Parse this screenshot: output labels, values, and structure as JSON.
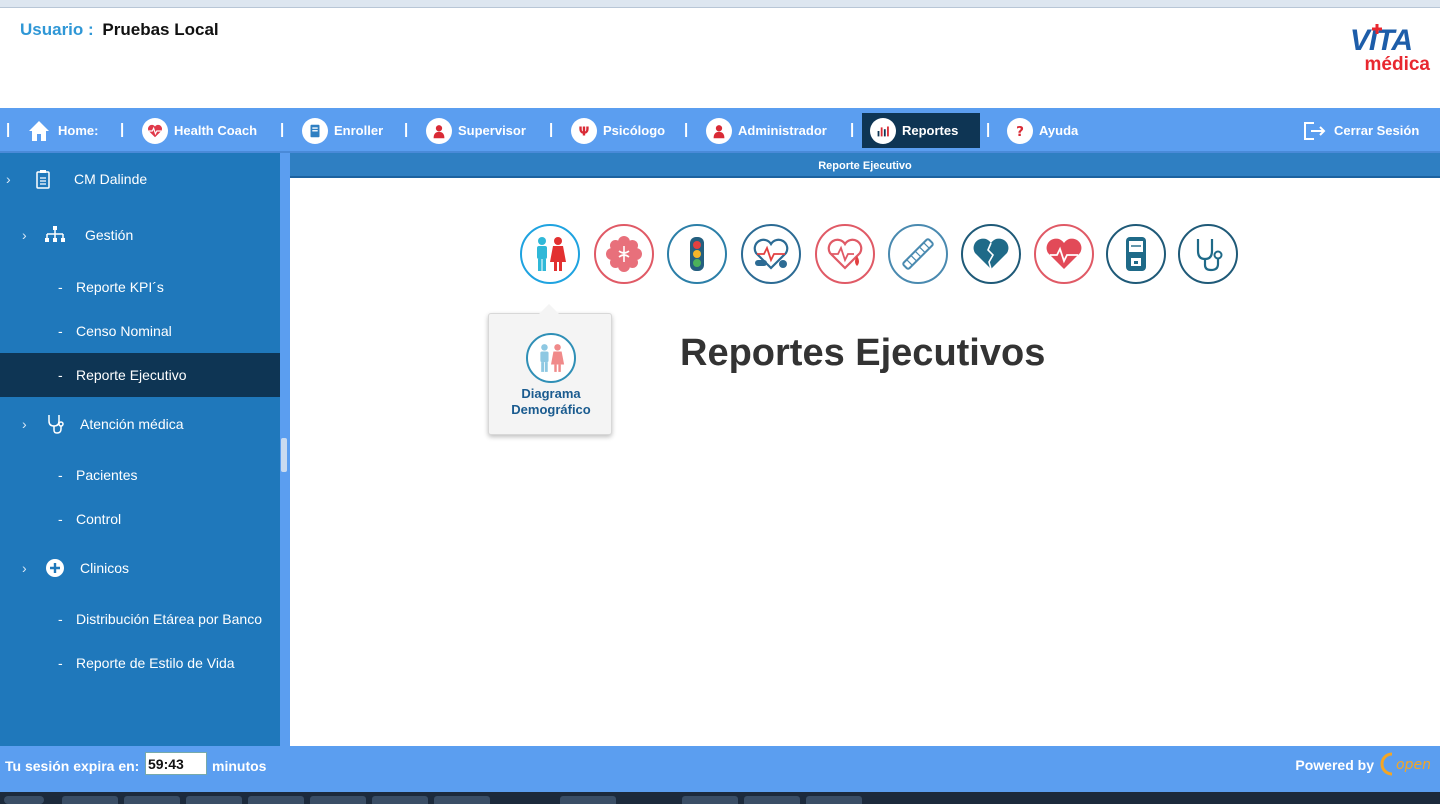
{
  "header": {
    "user_label": "Usuario :",
    "user_name": "Pruebas Local",
    "logo_vita": "VITA",
    "logo_medica": "médica"
  },
  "nav": {
    "home": "Home:",
    "health_coach": "Health Coach",
    "enroller": "Enroller",
    "supervisor": "Supervisor",
    "psicologo": "Psicólogo",
    "administrador": "Administrador",
    "reportes": "Reportes",
    "ayuda": "Ayuda",
    "cerrar_sesion": "Cerrar Sesión",
    "separator": "|"
  },
  "sidebar": {
    "center": "CM Dalinde",
    "gestion": "Gestión",
    "reporte_kpis": "Reporte KPI´s",
    "censo_nominal": "Censo Nominal",
    "reporte_ejecutivo": "Reporte Ejecutivo",
    "atencion_medica": "Atención médica",
    "pacientes": "Pacientes",
    "control": "Control",
    "clinicos": "Clinicos",
    "distribucion": "Distribución Etárea por Banco",
    "estilo_vida": "Reporte de Estilo de Vida",
    "dash": "-",
    "chevron": "›"
  },
  "content": {
    "bar_title": "Reporte Ejecutivo",
    "heading": "Reportes Ejecutivos",
    "tooltip_label_1": "Diagrama",
    "tooltip_label_2": "Demográfico",
    "report_icons": [
      "demographic-icon",
      "medical-star-icon",
      "traffic-light-icon",
      "heart-pills-icon",
      "heart-drop-icon",
      "syringe-icon",
      "broken-heart-icon",
      "heart-rate-icon",
      "glucometer-icon",
      "stethoscope-icon"
    ]
  },
  "footer": {
    "session_label": "Tu sesión expira en:",
    "session_time": "59:43",
    "session_unit": "minutos",
    "powered_by": "Powered by",
    "open_logo": "open"
  },
  "colors": {
    "nav_bg": "#5b9ef0",
    "sidebar_bg": "#1f78bb",
    "active_bg": "#0e3554",
    "accent_blue": "#2f97d6",
    "accent_red": "#e8272f"
  }
}
